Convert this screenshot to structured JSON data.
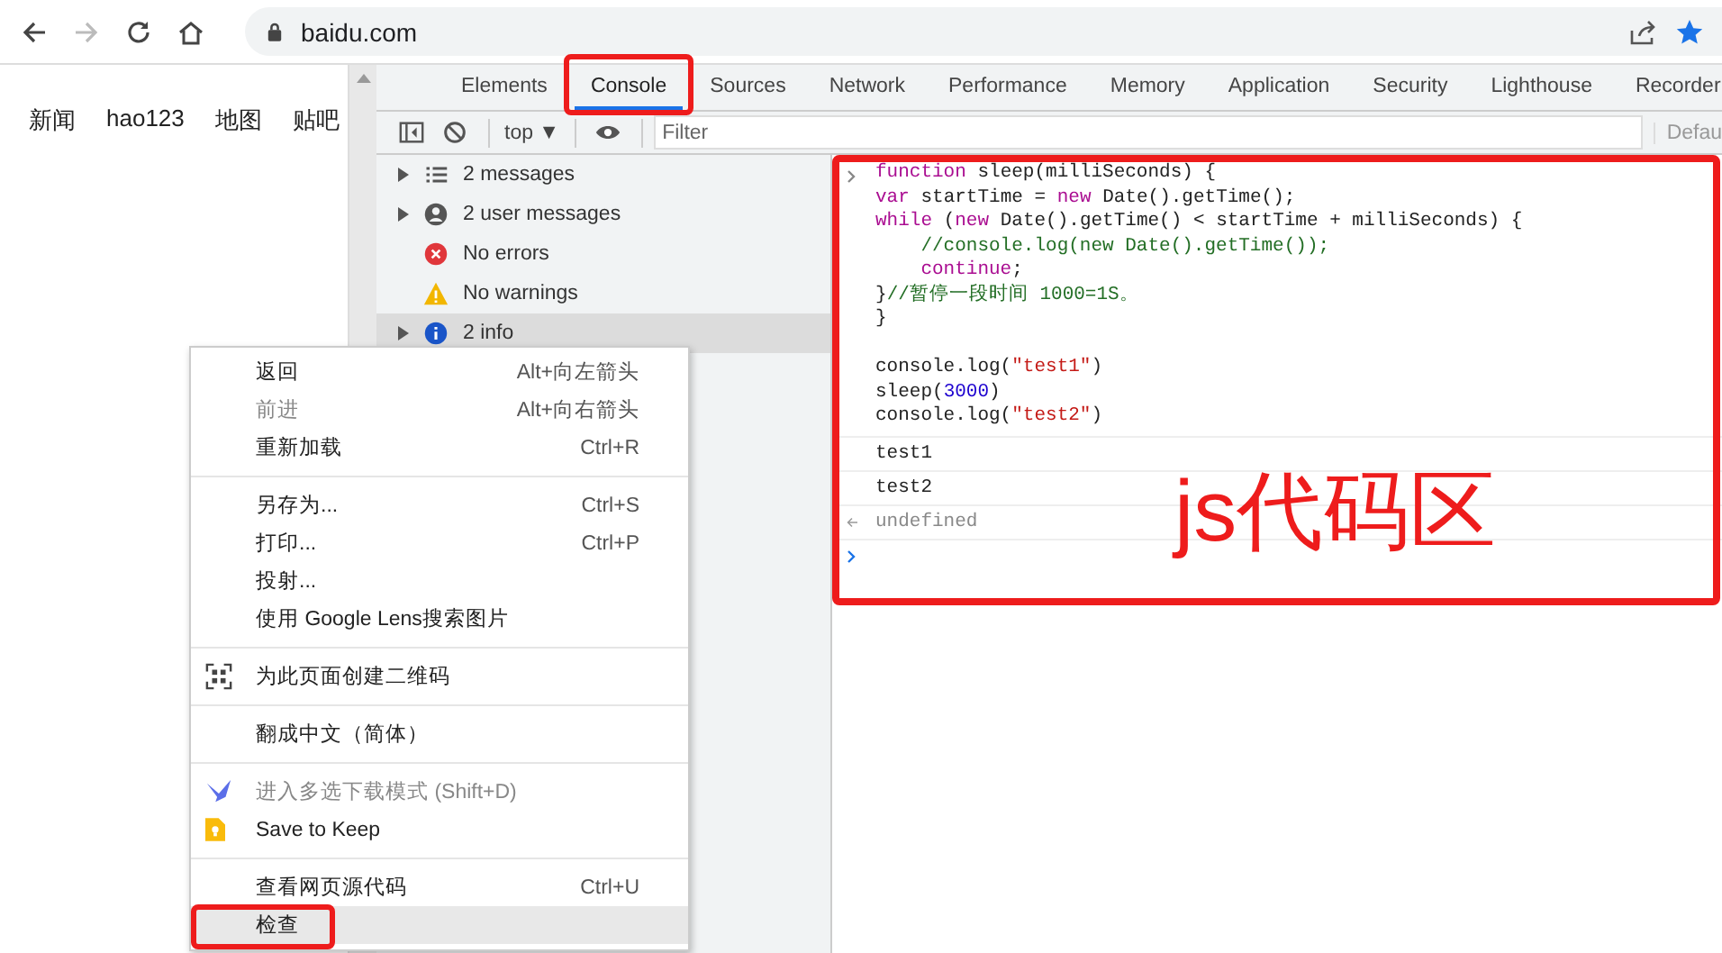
{
  "browser": {
    "address": "baidu.com",
    "bookmarked": true
  },
  "page_nav": [
    "新闻",
    "hao123",
    "地图",
    "贴吧"
  ],
  "devtools": {
    "tabs": [
      {
        "label": "Elements",
        "selected": false,
        "outlined": false
      },
      {
        "label": "Console",
        "selected": true,
        "outlined": true
      },
      {
        "label": "Sources",
        "selected": false,
        "outlined": false
      },
      {
        "label": "Network",
        "selected": false,
        "outlined": false
      },
      {
        "label": "Performance",
        "selected": false,
        "outlined": false
      },
      {
        "label": "Memory",
        "selected": false,
        "outlined": false
      },
      {
        "label": "Application",
        "selected": false,
        "outlined": false
      },
      {
        "label": "Security",
        "selected": false,
        "outlined": false
      },
      {
        "label": "Lighthouse",
        "selected": false,
        "outlined": false
      },
      {
        "label": "Recorder",
        "selected": false,
        "outlined": false
      }
    ],
    "context": "top ▼",
    "filter": {
      "placeholder": "Filter"
    },
    "levels": "Defau",
    "sidebar": [
      {
        "label": "2 messages",
        "kind": "list",
        "expandable": true,
        "selected": false
      },
      {
        "label": "2 user messages",
        "kind": "user",
        "expandable": true,
        "selected": false
      },
      {
        "label": "No errors",
        "kind": "error",
        "expandable": false,
        "selected": false
      },
      {
        "label": "No warnings",
        "kind": "warning",
        "expandable": false,
        "selected": false
      },
      {
        "label": "2 info",
        "kind": "info",
        "expandable": true,
        "selected": true
      }
    ],
    "console": {
      "outlined": true,
      "input": [
        [
          [
            {
              "text": "function ",
              "kind": "keyword"
            },
            {
              "text": "sleep(milliSeconds) {",
              "kind": "plain"
            }
          ],
          [
            {
              "text": "var ",
              "kind": "keyword"
            },
            {
              "text": "startTime = ",
              "kind": "plain"
            },
            {
              "text": "new ",
              "kind": "keyword"
            },
            {
              "text": "Date().getTime();",
              "kind": "plain"
            }
          ],
          [
            {
              "text": "while ",
              "kind": "keyword"
            },
            {
              "text": "(",
              "kind": "plain"
            },
            {
              "text": "new ",
              "kind": "keyword"
            },
            {
              "text": "Date().getTime() < startTime + milliSeconds) {",
              "kind": "plain"
            }
          ],
          [
            {
              "text": "    //console.log(new Date().getTime());",
              "kind": "comment"
            }
          ],
          [
            {
              "text": "    continue",
              "kind": "keyword"
            },
            {
              "text": ";",
              "kind": "plain"
            }
          ],
          [
            {
              "text": "}",
              "kind": "plain"
            },
            {
              "text": "//暂停一段时间 1000=1S。",
              "kind": "comment"
            }
          ],
          [
            {
              "text": "}",
              "kind": "plain"
            }
          ]
        ],
        [
          [
            {
              "text": "console.log(",
              "kind": "plain"
            },
            {
              "text": "\"test1\"",
              "kind": "string"
            },
            {
              "text": ")",
              "kind": "plain"
            }
          ],
          [
            {
              "text": "sleep(",
              "kind": "plain"
            },
            {
              "text": "3000",
              "kind": "number"
            },
            {
              "text": ")",
              "kind": "plain"
            }
          ],
          [
            {
              "text": "console.log(",
              "kind": "plain"
            },
            {
              "text": "\"test2\"",
              "kind": "string"
            },
            {
              "text": ")",
              "kind": "plain"
            }
          ]
        ]
      ],
      "output": [
        {
          "text": "test1",
          "kind": "log"
        },
        {
          "text": "test2",
          "kind": "log"
        },
        {
          "text": "undefined",
          "kind": "result"
        }
      ]
    },
    "annotation": "js代码区"
  },
  "context_menu": [
    [
      {
        "label": "返回",
        "shortcut": "Alt+向左箭头",
        "disabled": false,
        "selected": false,
        "outlined": false
      },
      {
        "label": "前进",
        "shortcut": "Alt+向右箭头",
        "disabled": true,
        "selected": false,
        "outlined": false
      },
      {
        "label": "重新加载",
        "shortcut": "Ctrl+R",
        "disabled": false,
        "selected": false,
        "outlined": false
      }
    ],
    [
      {
        "label": "另存为...",
        "shortcut": "Ctrl+S",
        "disabled": false,
        "selected": false,
        "outlined": false
      },
      {
        "label": "打印...",
        "shortcut": "Ctrl+P",
        "disabled": false,
        "selected": false,
        "outlined": false
      },
      {
        "label": "投射...",
        "disabled": false,
        "selected": false,
        "outlined": false
      },
      {
        "label": "使用 Google Lens搜索图片",
        "disabled": false,
        "selected": false,
        "outlined": false
      }
    ],
    [
      {
        "label": "为此页面创建二维码",
        "disabled": false,
        "kind": "qr",
        "selected": false,
        "outlined": false
      }
    ],
    [
      {
        "label": "翻成中文（简体）",
        "disabled": false,
        "selected": false,
        "outlined": false
      }
    ],
    [
      {
        "label": "进入多选下载模式 (Shift+D)",
        "disabled": true,
        "kind": "bird",
        "selected": false,
        "outlined": false
      },
      {
        "label": "Save to Keep",
        "disabled": false,
        "kind": "keep",
        "selected": false,
        "outlined": false
      }
    ],
    [
      {
        "label": "查看网页源代码",
        "shortcut": "Ctrl+U",
        "disabled": false,
        "selected": false,
        "outlined": false
      },
      {
        "label": "检查",
        "disabled": false,
        "selected": true,
        "outlined": true
      }
    ]
  ]
}
